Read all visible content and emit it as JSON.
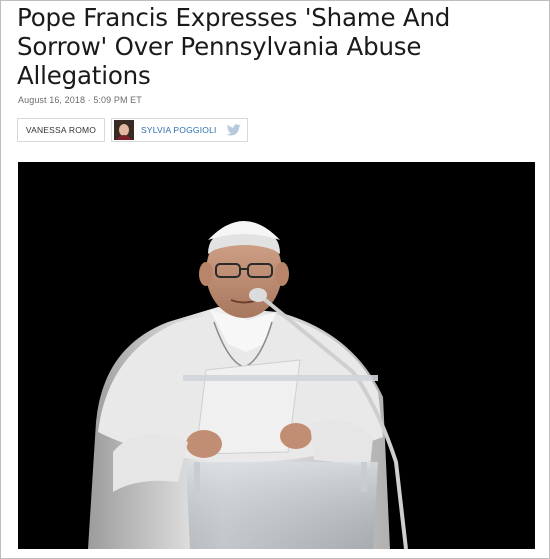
{
  "article": {
    "headline": "Pope Francis Expresses 'Shame And Sorrow' Over Pennsylvania Abuse Allegations",
    "dateline": "August 16, 2018 · 5:09 PM ET"
  },
  "bylines": [
    {
      "name": "VANESSA ROMO",
      "has_photo": false,
      "has_twitter": false
    },
    {
      "name": "SYLVIA POGGIOLI",
      "has_photo": true,
      "has_twitter": true
    }
  ],
  "icons": {
    "twitter": "twitter-icon"
  },
  "colors": {
    "link": "#2a6fb3",
    "twitter": "#b8c9dd",
    "headline": "#1a1a1a",
    "meta": "#6b6b6b"
  }
}
